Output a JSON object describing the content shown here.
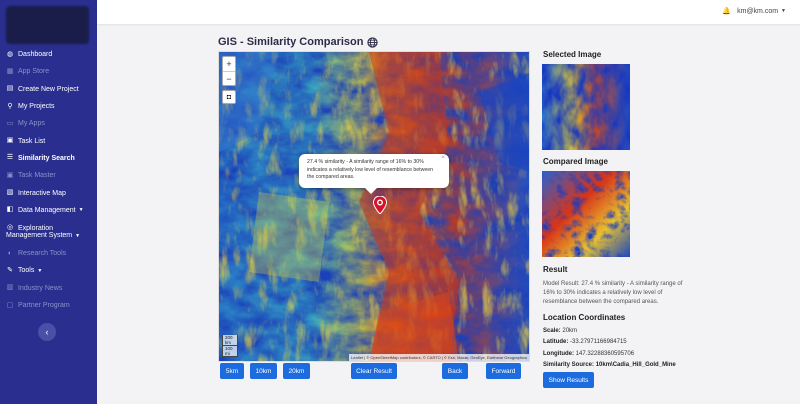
{
  "sidebar": {
    "items": [
      {
        "label": "Dashboard",
        "icon": "dashboard-icon",
        "glyph": "◍"
      },
      {
        "label": "App Store",
        "icon": "store-icon",
        "glyph": "▦"
      },
      {
        "label": "Create New Project",
        "icon": "create-project-icon",
        "glyph": "▤"
      },
      {
        "label": "My Projects",
        "icon": "projects-icon",
        "glyph": "⚲"
      },
      {
        "label": "My Apps",
        "icon": "apps-icon",
        "glyph": "▭"
      },
      {
        "label": "Task List",
        "icon": "task-list-icon",
        "glyph": "▣"
      },
      {
        "label": "Similarity Search",
        "icon": "similarity-search-icon",
        "glyph": "☰"
      },
      {
        "label": "Task Master",
        "icon": "task-master-icon",
        "glyph": "▣"
      },
      {
        "label": "Interactive Map",
        "icon": "map-icon",
        "glyph": "▧"
      },
      {
        "label": "Data Management",
        "icon": "database-icon",
        "glyph": "◧"
      },
      {
        "label": "Exploration",
        "label2": "Management System",
        "icon": "exploration-icon",
        "glyph": "◎"
      },
      {
        "label": "Research Tools",
        "icon": "research-icon",
        "glyph": "◐"
      },
      {
        "label": "Tools",
        "icon": "tools-icon",
        "glyph": "✎"
      },
      {
        "label": "Industry News",
        "icon": "news-icon",
        "glyph": "▥"
      },
      {
        "label": "Partner Program",
        "icon": "partner-icon",
        "glyph": "▢"
      }
    ],
    "collapse_glyph": "‹"
  },
  "topbar": {
    "user_email": "km@km.com",
    "bell_glyph": "🔔",
    "caret_glyph": "▼"
  },
  "main": {
    "title": "GIS - Similarity Comparison"
  },
  "map": {
    "zoom_in": "+",
    "zoom_out": "−",
    "layers_glyph": "◘",
    "popup_text": "27.4 % similarity - A similarity range of 16% to 30% indicates a relatively low level of resemblance between the compared areas.",
    "popup_close": "×",
    "scale_line1": "200 km",
    "scale_line2": "100 mi",
    "attribution": "Leaflet | © OpenStreetMap contributors, © CARTO | © Esri, Maxar, GeoEye, Earthstar Geographics"
  },
  "controls": {
    "btn_5km": "5km",
    "btn_10km": "10km",
    "btn_20km": "20km",
    "btn_clear": "Clear Result",
    "btn_back": "Back",
    "btn_forward": "Forward"
  },
  "right_panel": {
    "selected_title": "Selected Image",
    "compared_title": "Compared Image",
    "result_title": "Result",
    "result_text": "Model Result: 27.4 % similarity - A similarity range of 16% to 30% indicates a relatively low level of resemblance between the compared areas.",
    "coords_title": "Location Coordinates",
    "scale_label": "Scale:",
    "scale_value": "20km",
    "latitude_label": "Latitude:",
    "latitude_value": "-33.27971166984715",
    "longitude_label": "Longitude:",
    "longitude_value": "147.32288360595706",
    "source_label": "Similarity Source:",
    "source_value": "10km\\Cadia_Hill_Gold_Mine",
    "show_results": "Show Results"
  }
}
